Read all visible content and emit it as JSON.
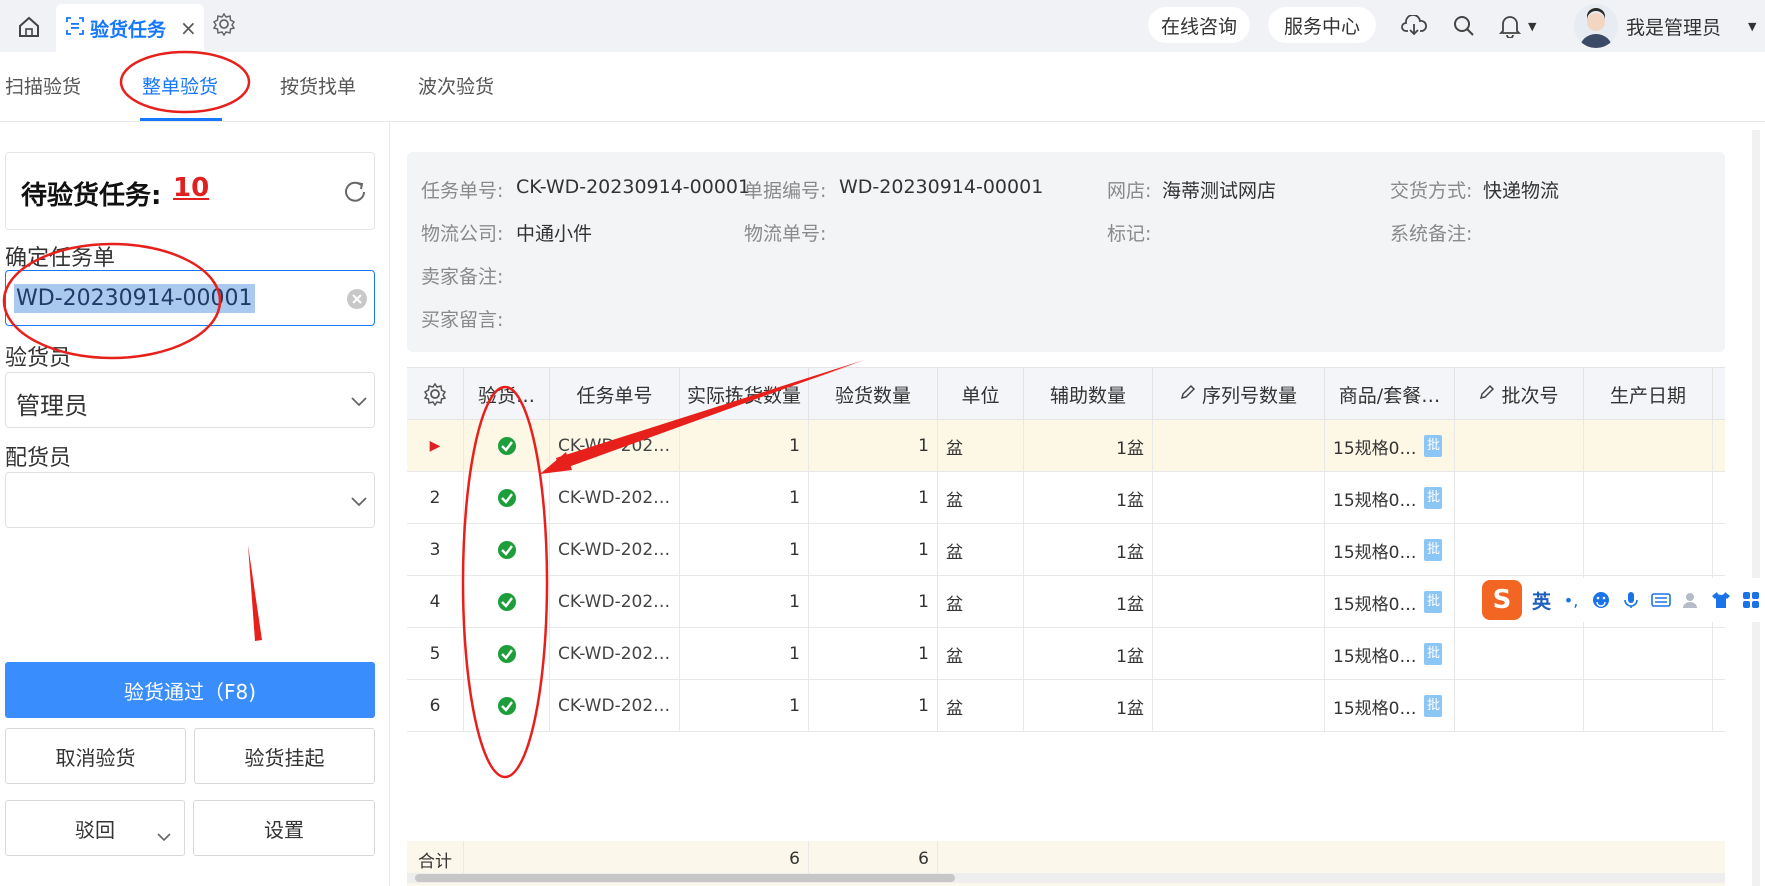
{
  "topbar": {
    "home_icon": "home-icon",
    "tab_icon": "scan-icon",
    "tab_title": "验货任务",
    "tab_close": "×",
    "settings_icon": "gear-icon",
    "online_consult": "在线咨询",
    "service_center": "服务中心",
    "user_name": "我是管理员"
  },
  "subtabs": [
    "扫描验货",
    "整单验货",
    "按货找单",
    "波次验货"
  ],
  "left": {
    "pending_label": "待验货任务:",
    "pending_count": "10",
    "confirm_label": "确定任务单",
    "task_value": "WD-20230914-00001",
    "inspector_label": "验货员",
    "inspector_value": "管理员",
    "distributor_label": "配货员",
    "distributor_value": "",
    "pass_button": "验货通过（F8)",
    "cancel_button": "取消验货",
    "suspend_button": "验货挂起",
    "reject_button": "驳回",
    "settings_button": "设置"
  },
  "info": {
    "task_no_label": "任务单号:",
    "task_no": "CK-WD-20230914-00001",
    "doc_no_label": "单据编号:",
    "doc_no": "WD-20230914-00001",
    "shop_label": "网店:",
    "shop": "海蒂测试网店",
    "delivery_label": "交货方式:",
    "delivery": "快递物流",
    "logistics_label": "物流公司:",
    "logistics": "中通小件",
    "tracking_label": "物流单号:",
    "mark_label": "标记:",
    "system_note_label": "系统备注:",
    "seller_note_label": "卖家备注:",
    "buyer_msg_label": "买家留言:"
  },
  "table": {
    "headers": [
      "验货…",
      "任务单号",
      "实际拣货数量",
      "验货数量",
      "单位",
      "辅助数量",
      "序列号数量",
      "商品/套餐…",
      "批次号",
      "生产日期"
    ],
    "rows": [
      {
        "idx": "▶",
        "task": "CK-WD-202…",
        "picked": "1",
        "checked": "1",
        "unit": "盆",
        "aux": "1盆",
        "product": "15规格0…",
        "batch": "批"
      },
      {
        "idx": "2",
        "task": "CK-WD-202…",
        "picked": "1",
        "checked": "1",
        "unit": "盆",
        "aux": "1盆",
        "product": "15规格0…",
        "batch": "批"
      },
      {
        "idx": "3",
        "task": "CK-WD-202…",
        "picked": "1",
        "checked": "1",
        "unit": "盆",
        "aux": "1盆",
        "product": "15规格0…",
        "batch": "批"
      },
      {
        "idx": "4",
        "task": "CK-WD-202…",
        "picked": "1",
        "checked": "1",
        "unit": "盆",
        "aux": "1盆",
        "product": "15规格0…",
        "batch": "批"
      },
      {
        "idx": "5",
        "task": "CK-WD-202…",
        "picked": "1",
        "checked": "1",
        "unit": "盆",
        "aux": "1盆",
        "product": "15规格0…",
        "batch": "批"
      },
      {
        "idx": "6",
        "task": "CK-WD-202…",
        "picked": "1",
        "checked": "1",
        "unit": "盆",
        "aux": "1盆",
        "product": "15规格0…",
        "batch": "批"
      }
    ],
    "footer_label": "合计",
    "footer_picked": "6",
    "footer_checked": "6"
  },
  "ime": {
    "logo": "S",
    "lang": "英"
  },
  "colors": {
    "accent": "#1677ff",
    "primary_button": "#3a8dfd",
    "count_red": "#e02020",
    "check_green": "#1e9e3a",
    "annotation_red": "#e8201c"
  }
}
